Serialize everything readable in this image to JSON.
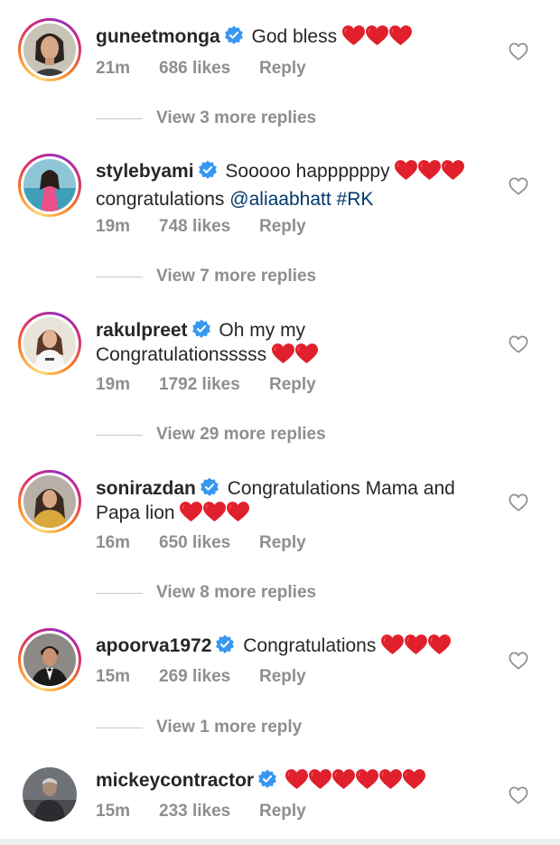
{
  "comments": [
    {
      "username": "guneetmonga",
      "text": "God bless",
      "hearts": 3,
      "time": "21m",
      "likes": "686 likes",
      "reply": "Reply",
      "view_replies": "View 3 more replies"
    },
    {
      "username": "stylebyami",
      "text": "Sooooo happppppy",
      "hearts": 3,
      "text_line2": "congratulations",
      "mention": "@aliaabhatt",
      "hashtag": "#RK",
      "time": "19m",
      "likes": "748 likes",
      "reply": "Reply",
      "view_replies": "View 7 more replies"
    },
    {
      "username": "rakulpreet",
      "text": "Oh my my",
      "text_line2": "Congratulationsssss",
      "hearts": 2,
      "time": "19m",
      "likes": "1792 likes",
      "reply": "Reply",
      "view_replies": "View 29 more replies"
    },
    {
      "username": "sonirazdan",
      "text": "Congratulations Mama and",
      "text_line2": "Papa lion",
      "hearts": 3,
      "time": "16m",
      "likes": "650 likes",
      "reply": "Reply",
      "view_replies": "View 8 more replies"
    },
    {
      "username": "apoorva1972",
      "text": "Congratulations",
      "hearts": 3,
      "time": "15m",
      "likes": "269 likes",
      "reply": "Reply",
      "view_replies": "View 1 more reply"
    },
    {
      "username": "mickeycontractor",
      "text": "",
      "hearts": 6,
      "time": "15m",
      "likes": "233 likes",
      "reply": "Reply"
    }
  ],
  "icons": {
    "verified": "verified-badge-icon",
    "heart_emoji": "red-heart-emoji",
    "like": "heart-outline-icon"
  },
  "colors": {
    "verified_blue": "#3897f0",
    "heart_red": "#e0202c",
    "meta_grey": "#8e8e8e",
    "mention_blue": "#00376b"
  }
}
